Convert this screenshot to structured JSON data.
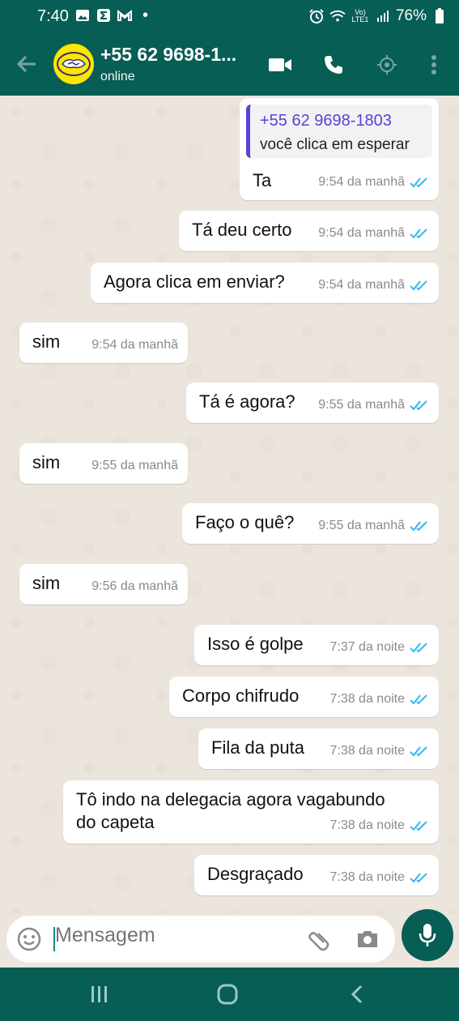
{
  "status_bar": {
    "time": "7:40",
    "dot": "•",
    "signal_label": "Vo) LTE1",
    "battery": "76%"
  },
  "header": {
    "contact_name": "+55 62 9698-1...",
    "status": "online",
    "icons": [
      "back-arrow-icon",
      "video-call-icon",
      "phone-call-icon",
      "location-icon",
      "more-vert-icon"
    ]
  },
  "messages": [
    {
      "dir": "out",
      "quote_author": "+55 62 9698-1803",
      "quote_text": "você clica em esperar",
      "text": "Ta",
      "time": "9:54 da manhã",
      "read": true
    },
    {
      "dir": "out",
      "text": "Tá deu certo",
      "time": "9:54 da manhã",
      "read": true
    },
    {
      "dir": "out",
      "text": "Agora clica em enviar?",
      "time": "9:54 da manhã",
      "read": true
    },
    {
      "dir": "in",
      "text": "sim",
      "time": "9:54 da manhã"
    },
    {
      "dir": "out",
      "text": "Tá é agora?",
      "time": "9:55 da manhã",
      "read": true
    },
    {
      "dir": "in",
      "text": "sim",
      "time": "9:55 da manhã"
    },
    {
      "dir": "out",
      "text": "Faço o quê?",
      "time": "9:55 da manhã",
      "read": true
    },
    {
      "dir": "in",
      "text": "sim",
      "time": "9:56 da manhã"
    },
    {
      "dir": "out",
      "text": "Isso é golpe",
      "time": "7:37 da noite",
      "read": true
    },
    {
      "dir": "out",
      "text": "Corpo chifrudo",
      "time": "7:38 da noite",
      "read": true
    },
    {
      "dir": "out",
      "text": "Fila da puta",
      "time": "7:38 da noite",
      "read": true
    },
    {
      "dir": "out",
      "text_line1": "Tô indo na delegacia agora vagabundo",
      "text_line2": "do capeta",
      "time": "7:38 da noite",
      "read": true
    },
    {
      "dir": "out",
      "text": "Desgraçado",
      "time": "7:38 da noite",
      "read": true
    }
  ],
  "composer": {
    "placeholder": "Mensagem"
  },
  "colors": {
    "header": "#075e54",
    "read_tick": "#34b7f1",
    "quote_accent": "#5b3fd6"
  }
}
